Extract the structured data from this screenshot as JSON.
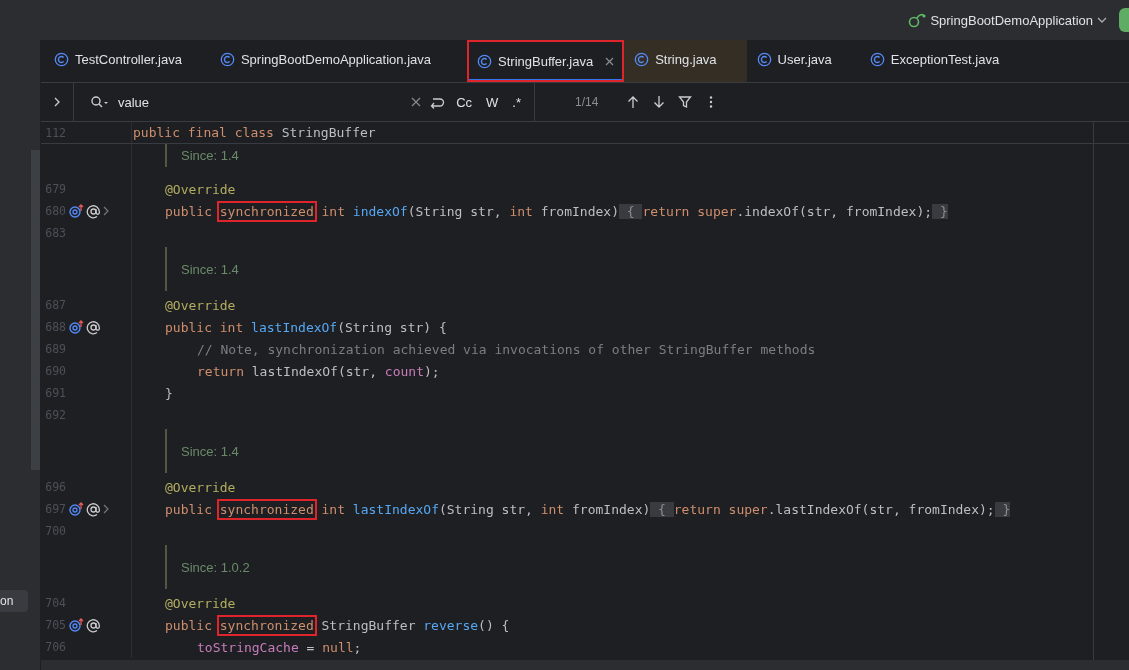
{
  "run_config": {
    "label": "SpringBootDemoApplication"
  },
  "tabs": [
    {
      "label": "TestController.java",
      "selected": false,
      "tinted": false,
      "marked": false,
      "closable": false
    },
    {
      "label": "SpringBootDemoApplication.java",
      "selected": false,
      "tinted": false,
      "marked": false,
      "closable": false
    },
    {
      "label": "StringBuffer.java",
      "selected": true,
      "tinted": false,
      "marked": true,
      "closable": true
    },
    {
      "label": "String.java",
      "selected": false,
      "tinted": true,
      "marked": false,
      "closable": false
    },
    {
      "label": "User.java",
      "selected": false,
      "tinted": false,
      "marked": false,
      "closable": false
    },
    {
      "label": "ExceptionTest.java",
      "selected": false,
      "tinted": false,
      "marked": false,
      "closable": false
    }
  ],
  "search": {
    "value": "value",
    "match_case_label": "Cc",
    "words_label": "W",
    "regex_label": ".*",
    "match_count": "1/14"
  },
  "sidebar": {
    "items": [
      {
        "label": "on"
      }
    ]
  },
  "sticky_line": {
    "number": "112",
    "tokens": [
      {
        "kind": "keyword",
        "text": "public final class "
      },
      {
        "kind": "plain",
        "text": "StringBuffer"
      }
    ]
  },
  "rows": [
    {
      "kind": "doc",
      "text": "Since: 1.4"
    },
    {
      "kind": "code",
      "number": "679",
      "tokens": [
        {
          "kind": "annotation",
          "text": "@Override"
        }
      ]
    },
    {
      "kind": "code",
      "number": "680",
      "gutter": [
        {
          "kind": "override"
        },
        {
          "kind": "annotation"
        },
        {
          "kind": "fold"
        }
      ],
      "tokens": [
        {
          "kind": "keyword",
          "text": "public "
        },
        {
          "kind": "keyword",
          "text": "synchronized",
          "boxed": true
        },
        {
          "kind": "keyword",
          "text": " int "
        },
        {
          "kind": "method",
          "text": "indexOf"
        },
        {
          "kind": "plain",
          "text": "(String str, "
        },
        {
          "kind": "keyword",
          "text": "int "
        },
        {
          "kind": "plain",
          "text": "fromIndex)"
        },
        {
          "kind": "folded",
          "text": " { "
        },
        {
          "kind": "keyword",
          "text": "return super"
        },
        {
          "kind": "plain",
          "text": ".indexOf(str, fromIndex);"
        },
        {
          "kind": "folded",
          "text": " }"
        }
      ]
    },
    {
      "kind": "code",
      "number": "683"
    },
    {
      "kind": "doc",
      "text": "Since: 1.4"
    },
    {
      "kind": "code",
      "number": "687",
      "tokens": [
        {
          "kind": "annotation",
          "text": "@Override"
        }
      ]
    },
    {
      "kind": "code",
      "number": "688",
      "gutter": [
        {
          "kind": "override"
        },
        {
          "kind": "annotation"
        }
      ],
      "tokens": [
        {
          "kind": "keyword",
          "text": "public int "
        },
        {
          "kind": "method",
          "text": "lastIndexOf"
        },
        {
          "kind": "plain",
          "text": "(String str) {"
        }
      ],
      "children": [
        {
          "kind": "code",
          "number": "689",
          "tokens": [
            {
              "kind": "comment",
              "text": "// Note, synchronization achieved via invocations of other StringBuffer methods"
            }
          ]
        },
        {
          "kind": "code",
          "number": "690",
          "tokens": [
            {
              "kind": "keyword",
              "text": "return "
            },
            {
              "kind": "plain",
              "text": "lastIndexOf(str, "
            },
            {
              "kind": "field",
              "text": "count"
            },
            {
              "kind": "plain",
              "text": ");"
            }
          ]
        }
      ]
    },
    {
      "kind": "code",
      "number": "691",
      "tokens": [
        {
          "kind": "plain",
          "text": "}"
        }
      ]
    },
    {
      "kind": "code",
      "number": "692"
    },
    {
      "kind": "doc",
      "text": "Since: 1.4"
    },
    {
      "kind": "code",
      "number": "696",
      "tokens": [
        {
          "kind": "annotation",
          "text": "@Override"
        }
      ]
    },
    {
      "kind": "code",
      "number": "697",
      "gutter": [
        {
          "kind": "override"
        },
        {
          "kind": "annotation"
        },
        {
          "kind": "fold"
        }
      ],
      "tokens": [
        {
          "kind": "keyword",
          "text": "public "
        },
        {
          "kind": "keyword",
          "text": "synchronized",
          "boxed": true
        },
        {
          "kind": "keyword",
          "text": " int "
        },
        {
          "kind": "method",
          "text": "lastIndexOf"
        },
        {
          "kind": "plain",
          "text": "(String str, "
        },
        {
          "kind": "keyword",
          "text": "int "
        },
        {
          "kind": "plain",
          "text": "fromIndex)"
        },
        {
          "kind": "folded",
          "text": " { "
        },
        {
          "kind": "keyword",
          "text": "return super"
        },
        {
          "kind": "plain",
          "text": ".lastIndexOf(str, fromIndex);"
        },
        {
          "kind": "folded",
          "text": " }"
        }
      ]
    },
    {
      "kind": "code",
      "number": "700"
    },
    {
      "kind": "doc",
      "text": "Since: 1.0.2"
    },
    {
      "kind": "code",
      "number": "704",
      "tokens": [
        {
          "kind": "annotation",
          "text": "@Override"
        }
      ]
    },
    {
      "kind": "code",
      "number": "705",
      "gutter": [
        {
          "kind": "override"
        },
        {
          "kind": "annotation"
        }
      ],
      "tokens": [
        {
          "kind": "keyword",
          "text": "public "
        },
        {
          "kind": "keyword",
          "text": "synchronized",
          "boxed": true
        },
        {
          "kind": "plain",
          "text": " StringBuffer "
        },
        {
          "kind": "method",
          "text": "reverse"
        },
        {
          "kind": "plain",
          "text": "() {"
        }
      ],
      "children": [
        {
          "kind": "code",
          "number": "706",
          "tokens": [
            {
              "kind": "field",
              "text": "toStringCache"
            },
            {
              "kind": "plain",
              "text": " = "
            },
            {
              "kind": "keyword",
              "text": "null"
            },
            {
              "kind": "plain",
              "text": ";"
            }
          ]
        }
      ]
    }
  ]
}
